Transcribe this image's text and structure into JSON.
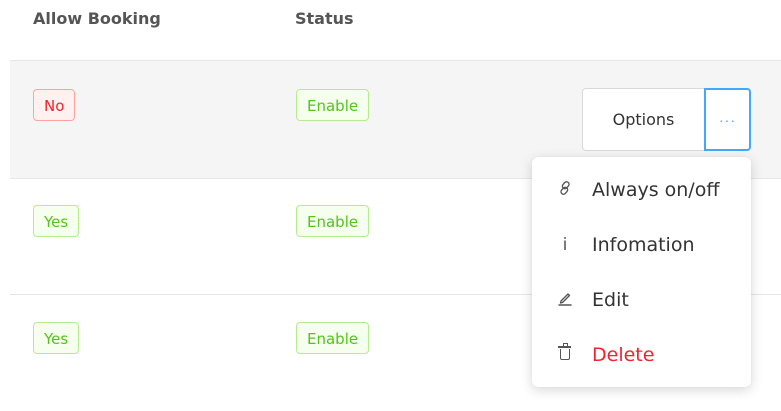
{
  "table": {
    "columns": [
      "Allow Booking",
      "Status"
    ],
    "rows": [
      {
        "allow_booking": "No",
        "status": "Enable"
      },
      {
        "allow_booking": "Yes",
        "status": "Enable"
      },
      {
        "allow_booking": "Yes",
        "status": "Enable"
      }
    ]
  },
  "actions": {
    "options_label": "Options",
    "more_label": "···"
  },
  "menu": {
    "items": [
      {
        "label": "Always on/off",
        "icon": "link-icon"
      },
      {
        "label": "Infomation",
        "icon": "info-icon"
      },
      {
        "label": "Edit",
        "icon": "edit-icon"
      },
      {
        "label": "Delete",
        "icon": "trash-icon"
      }
    ]
  },
  "colors": {
    "danger": "#f5222d",
    "success": "#52c41a",
    "primary": "#40a9ff"
  }
}
